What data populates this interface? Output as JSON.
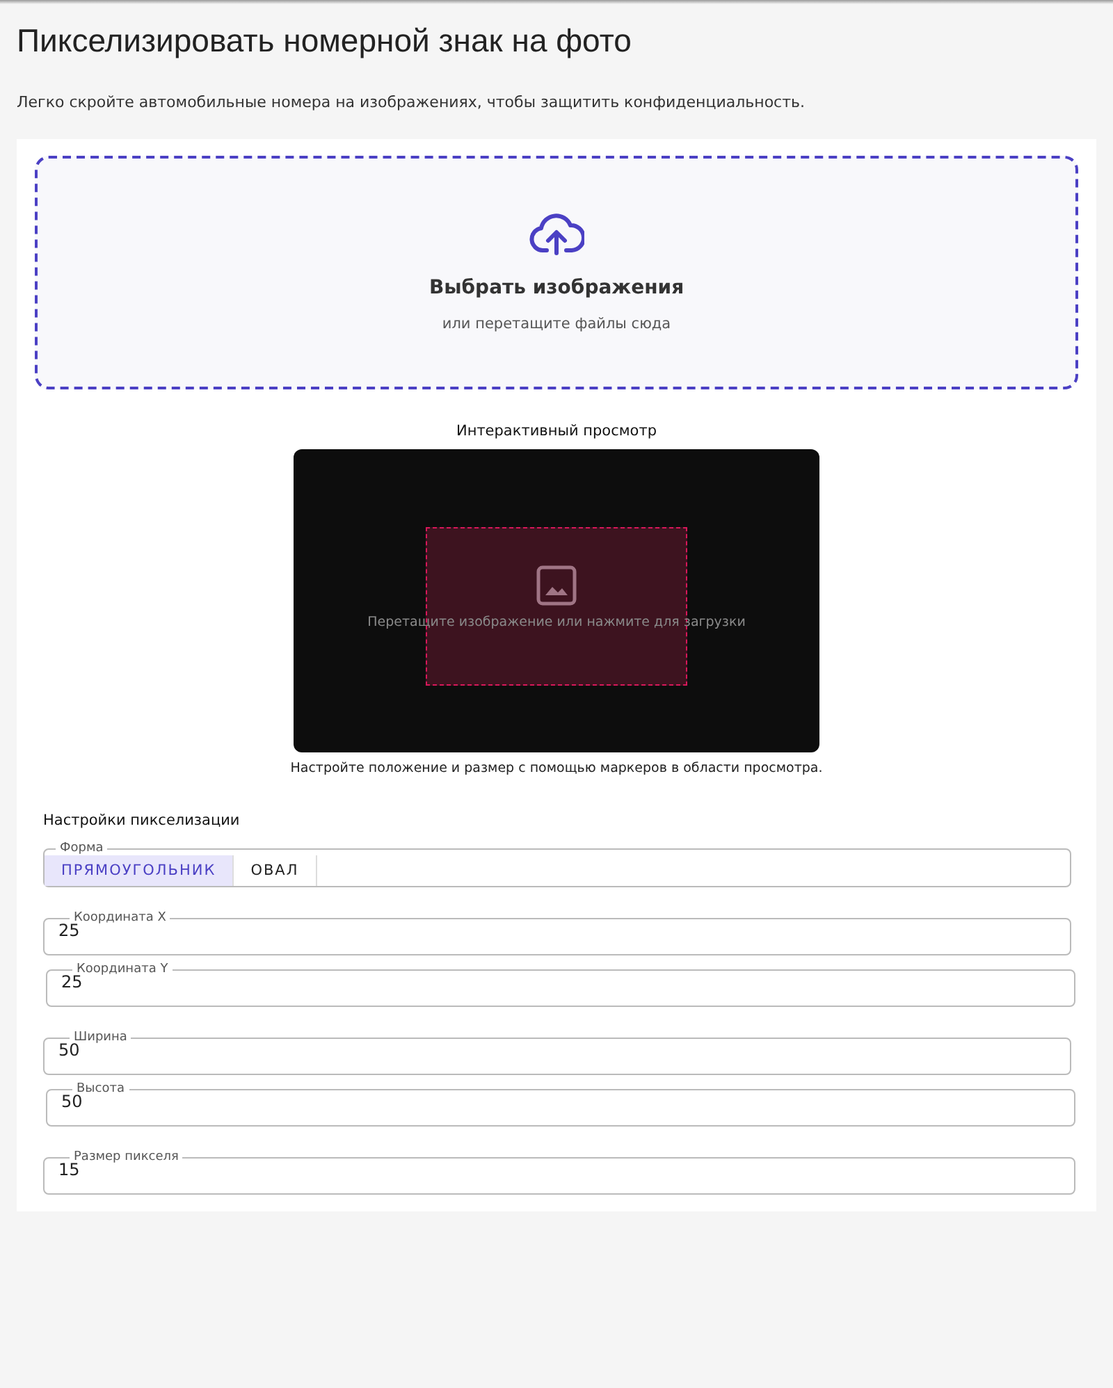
{
  "page": {
    "title": "Пикселизировать номерной знак на фото",
    "subtitle": "Легко скройте автомобильные номера на изображениях, чтобы защитить конфиденциальность."
  },
  "upload": {
    "button": "Выбрать изображения",
    "hint": "или перетащите файлы сюда"
  },
  "preview": {
    "title": "Интерактивный просмотр",
    "placeholder": "Перетащите изображение или нажмите для загрузки",
    "caption": "Настройте положение и размер с помощью маркеров в области просмотра."
  },
  "settings": {
    "title": "Настройки пикселизации",
    "shape": {
      "label": "Форма",
      "options": [
        {
          "label": "ПРЯМОУГОЛЬНИК",
          "selected": true
        },
        {
          "label": "ОВАЛ",
          "selected": false
        }
      ]
    },
    "fields": [
      {
        "label": "Координата X",
        "value": "25"
      },
      {
        "label": "Координата Y",
        "value": "25"
      },
      {
        "label": "Ширина",
        "value": "50"
      },
      {
        "label": "Высота",
        "value": "50"
      },
      {
        "label": "Размер пикселя",
        "value": "15"
      }
    ]
  }
}
